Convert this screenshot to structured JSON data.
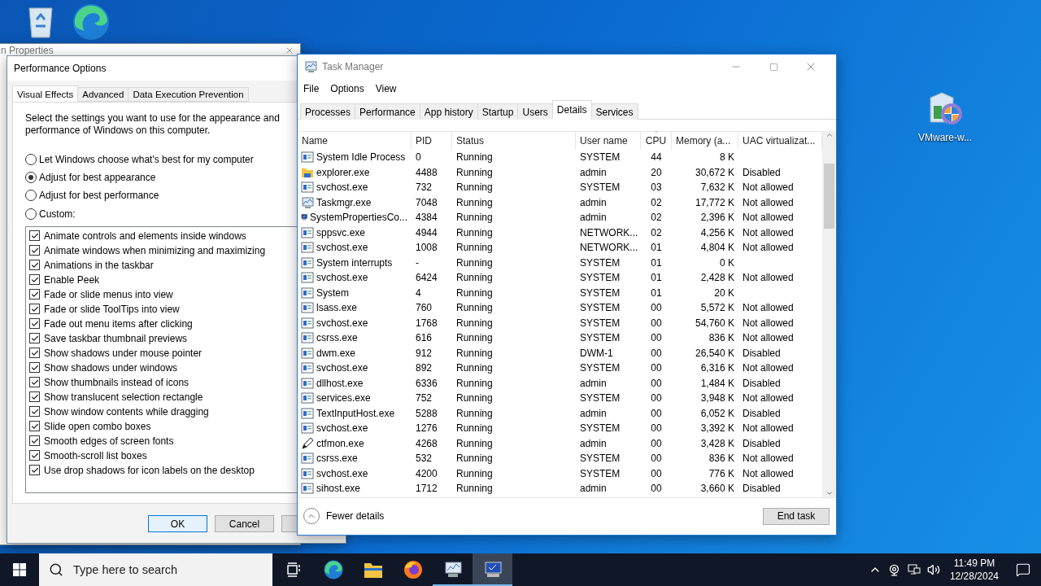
{
  "desktop_icons": [
    {
      "kind": "recycle-bin"
    },
    {
      "kind": "edge"
    },
    {
      "kind": "installer",
      "label": "VMware-w..."
    }
  ],
  "background_window": {
    "title": "n Properties"
  },
  "performance_options": {
    "title": "Performance Options",
    "tabs": [
      {
        "label": "Visual Effects",
        "selected": true
      },
      {
        "label": "Advanced",
        "selected": false
      },
      {
        "label": "Data Execution Prevention",
        "selected": false
      }
    ],
    "description": "Select the settings you want to use for the appearance and performance of Windows on this computer.",
    "radios": [
      {
        "label": "Let Windows choose what's best for my computer",
        "selected": false
      },
      {
        "label": "Adjust for best appearance",
        "selected": true
      },
      {
        "label": "Adjust for best performance",
        "selected": false
      },
      {
        "label": "Custom:",
        "selected": false
      }
    ],
    "effects": [
      {
        "label": "Animate controls and elements inside windows",
        "checked": true
      },
      {
        "label": "Animate windows when minimizing and maximizing",
        "checked": true
      },
      {
        "label": "Animations in the taskbar",
        "checked": true
      },
      {
        "label": "Enable Peek",
        "checked": true
      },
      {
        "label": "Fade or slide menus into view",
        "checked": true
      },
      {
        "label": "Fade or slide ToolTips into view",
        "checked": true
      },
      {
        "label": "Fade out menu items after clicking",
        "checked": true
      },
      {
        "label": "Save taskbar thumbnail previews",
        "checked": true
      },
      {
        "label": "Show shadows under mouse pointer",
        "checked": true
      },
      {
        "label": "Show shadows under windows",
        "checked": true
      },
      {
        "label": "Show thumbnails instead of icons",
        "checked": true
      },
      {
        "label": "Show translucent selection rectangle",
        "checked": true
      },
      {
        "label": "Show window contents while dragging",
        "checked": true
      },
      {
        "label": "Slide open combo boxes",
        "checked": true
      },
      {
        "label": "Smooth edges of screen fonts",
        "checked": true
      },
      {
        "label": "Smooth-scroll list boxes",
        "checked": true
      },
      {
        "label": "Use drop shadows for icon labels on the desktop",
        "checked": true
      }
    ],
    "buttons": [
      {
        "label": "OK",
        "kind": "default"
      },
      {
        "label": "Cancel",
        "kind": "normal"
      },
      {
        "kind": "normal"
      }
    ]
  },
  "task_manager": {
    "title": "Task Manager",
    "menu": [
      "File",
      "Options",
      "View"
    ],
    "tabs": [
      {
        "label": "Processes",
        "selected": false
      },
      {
        "label": "Performance",
        "selected": false
      },
      {
        "label": "App history",
        "selected": false
      },
      {
        "label": "Startup",
        "selected": false
      },
      {
        "label": "Users",
        "selected": false
      },
      {
        "label": "Details",
        "selected": true
      },
      {
        "label": "Services",
        "selected": false
      }
    ],
    "columns": [
      {
        "label": "Name",
        "sorted": false
      },
      {
        "label": "PID",
        "sorted": false
      },
      {
        "label": "Status",
        "sorted": false
      },
      {
        "label": "User name",
        "sorted": false
      },
      {
        "label": "CPU",
        "sorted": true
      },
      {
        "label": "Memory (a...",
        "sorted": false
      },
      {
        "label": "UAC virtualizat...",
        "sorted": false
      }
    ],
    "rows": [
      {
        "kind": "window",
        "name": "System Idle Process",
        "pid": "0",
        "status": "Running",
        "user": "SYSTEM",
        "cpu": "44",
        "memory": "8 K"
      },
      {
        "kind": "folder",
        "name": "explorer.exe",
        "pid": "4488",
        "status": "Running",
        "user": "admin",
        "cpu": "20",
        "memory": "30,672 K",
        "uac": "Disabled"
      },
      {
        "kind": "window",
        "name": "svchost.exe",
        "pid": "732",
        "status": "Running",
        "user": "SYSTEM",
        "cpu": "03",
        "memory": "7,632 K",
        "uac": "Not allowed"
      },
      {
        "kind": "monitor",
        "name": "Taskmgr.exe",
        "pid": "7048",
        "status": "Running",
        "user": "admin",
        "cpu": "02",
        "memory": "17,772 K",
        "uac": "Not allowed"
      },
      {
        "kind": "computer",
        "name": "SystemPropertiesCo...",
        "pid": "4384",
        "status": "Running",
        "user": "admin",
        "cpu": "02",
        "memory": "2,396 K",
        "uac": "Not allowed"
      },
      {
        "kind": "window",
        "name": "sppsvc.exe",
        "pid": "4944",
        "status": "Running",
        "user": "NETWORK...",
        "cpu": "02",
        "memory": "4,256 K",
        "uac": "Not allowed"
      },
      {
        "kind": "window",
        "name": "svchost.exe",
        "pid": "1008",
        "status": "Running",
        "user": "NETWORK...",
        "cpu": "01",
        "memory": "4,804 K",
        "uac": "Not allowed"
      },
      {
        "kind": "window",
        "name": "System interrupts",
        "pid": "-",
        "status": "Running",
        "user": "SYSTEM",
        "cpu": "01",
        "memory": "0 K"
      },
      {
        "kind": "window",
        "name": "svchost.exe",
        "pid": "6424",
        "status": "Running",
        "user": "SYSTEM",
        "cpu": "01",
        "memory": "2,428 K",
        "uac": "Not allowed"
      },
      {
        "kind": "window",
        "name": "System",
        "pid": "4",
        "status": "Running",
        "user": "SYSTEM",
        "cpu": "01",
        "memory": "20 K"
      },
      {
        "kind": "window",
        "name": "lsass.exe",
        "pid": "760",
        "status": "Running",
        "user": "SYSTEM",
        "cpu": "00",
        "memory": "5,572 K",
        "uac": "Not allowed"
      },
      {
        "kind": "window",
        "name": "svchost.exe",
        "pid": "1768",
        "status": "Running",
        "user": "SYSTEM",
        "cpu": "00",
        "memory": "54,760 K",
        "uac": "Not allowed"
      },
      {
        "kind": "window",
        "name": "csrss.exe",
        "pid": "616",
        "status": "Running",
        "user": "SYSTEM",
        "cpu": "00",
        "memory": "836 K",
        "uac": "Not allowed"
      },
      {
        "kind": "window",
        "name": "dwm.exe",
        "pid": "912",
        "status": "Running",
        "user": "DWM-1",
        "cpu": "00",
        "memory": "26,540 K",
        "uac": "Disabled"
      },
      {
        "kind": "window",
        "name": "svchost.exe",
        "pid": "892",
        "status": "Running",
        "user": "SYSTEM",
        "cpu": "00",
        "memory": "6,316 K",
        "uac": "Not allowed"
      },
      {
        "kind": "window",
        "name": "dllhost.exe",
        "pid": "6336",
        "status": "Running",
        "user": "admin",
        "cpu": "00",
        "memory": "1,484 K",
        "uac": "Disabled"
      },
      {
        "kind": "window",
        "name": "services.exe",
        "pid": "752",
        "status": "Running",
        "user": "SYSTEM",
        "cpu": "00",
        "memory": "3,948 K",
        "uac": "Not allowed"
      },
      {
        "kind": "window",
        "name": "TextInputHost.exe",
        "pid": "5288",
        "status": "Running",
        "user": "admin",
        "cpu": "00",
        "memory": "6,052 K",
        "uac": "Disabled"
      },
      {
        "kind": "window",
        "name": "svchost.exe",
        "pid": "1276",
        "status": "Running",
        "user": "SYSTEM",
        "cpu": "00",
        "memory": "3,392 K",
        "uac": "Not allowed"
      },
      {
        "kind": "pen",
        "name": "ctfmon.exe",
        "pid": "4268",
        "status": "Running",
        "user": "admin",
        "cpu": "00",
        "memory": "3,428 K",
        "uac": "Disabled"
      },
      {
        "kind": "window",
        "name": "csrss.exe",
        "pid": "532",
        "status": "Running",
        "user": "SYSTEM",
        "cpu": "00",
        "memory": "836 K",
        "uac": "Not allowed"
      },
      {
        "kind": "window",
        "name": "svchost.exe",
        "pid": "4200",
        "status": "Running",
        "user": "SYSTEM",
        "cpu": "00",
        "memory": "776 K",
        "uac": "Not allowed"
      },
      {
        "kind": "window",
        "name": "sihost.exe",
        "pid": "1712",
        "status": "Running",
        "user": "admin",
        "cpu": "00",
        "memory": "3,660 K",
        "uac": "Disabled"
      }
    ],
    "fewer_details": "Fewer details",
    "end_task": "End task"
  },
  "taskbar": {
    "search_placeholder": "Type here to search",
    "apps": [
      {
        "kind": "task-view",
        "running": false,
        "active": false
      },
      {
        "kind": "edge",
        "running": false,
        "active": false
      },
      {
        "kind": "explorer",
        "running": false,
        "active": false
      },
      {
        "kind": "firefox",
        "running": false,
        "active": false
      },
      {
        "kind": "task-manager",
        "running": true,
        "active": false
      },
      {
        "kind": "system-properties",
        "running": true,
        "active": true
      }
    ],
    "time": "11:49 PM",
    "date": "12/28/2024"
  }
}
